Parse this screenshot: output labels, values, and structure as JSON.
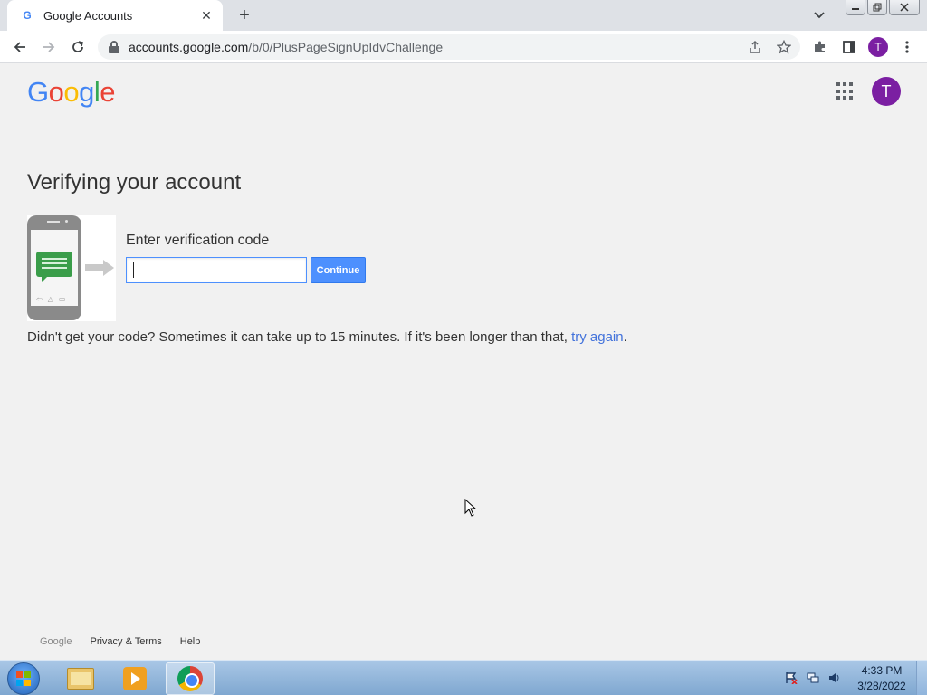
{
  "browser": {
    "tab_title": "Google Accounts",
    "tab_favicon": "G",
    "close_tab": "✕",
    "new_tab": "+",
    "url_host": "accounts.google.com",
    "url_path": "/b/0/PlusPageSignUpIdvChallenge",
    "profile_initial": "T"
  },
  "page": {
    "logo_letters": [
      "G",
      "o",
      "o",
      "g",
      "l",
      "e"
    ],
    "logo_colors": [
      "#4285f4",
      "#ea4335",
      "#fbbc05",
      "#4285f4",
      "#34a853",
      "#ea4335"
    ],
    "avatar_initial": "T",
    "title": "Verifying your account",
    "code_label": "Enter verification code",
    "code_value": "",
    "continue_label": "Continue",
    "hint_text": "Didn't get your code? Sometimes it can take up to 15 minutes. If it's been longer than that, ",
    "hint_link": "try again",
    "hint_end": "."
  },
  "footer": {
    "brand": "Google",
    "privacy": "Privacy & Terms",
    "help": "Help"
  },
  "taskbar": {
    "time": "4:33 PM",
    "date": "3/28/2022",
    "apps": [
      "windows-explorer",
      "media-player",
      "google-chrome"
    ]
  },
  "colors": {
    "accent": "#4d90fe",
    "link": "#4272db",
    "avatar": "#7b1fa2"
  }
}
